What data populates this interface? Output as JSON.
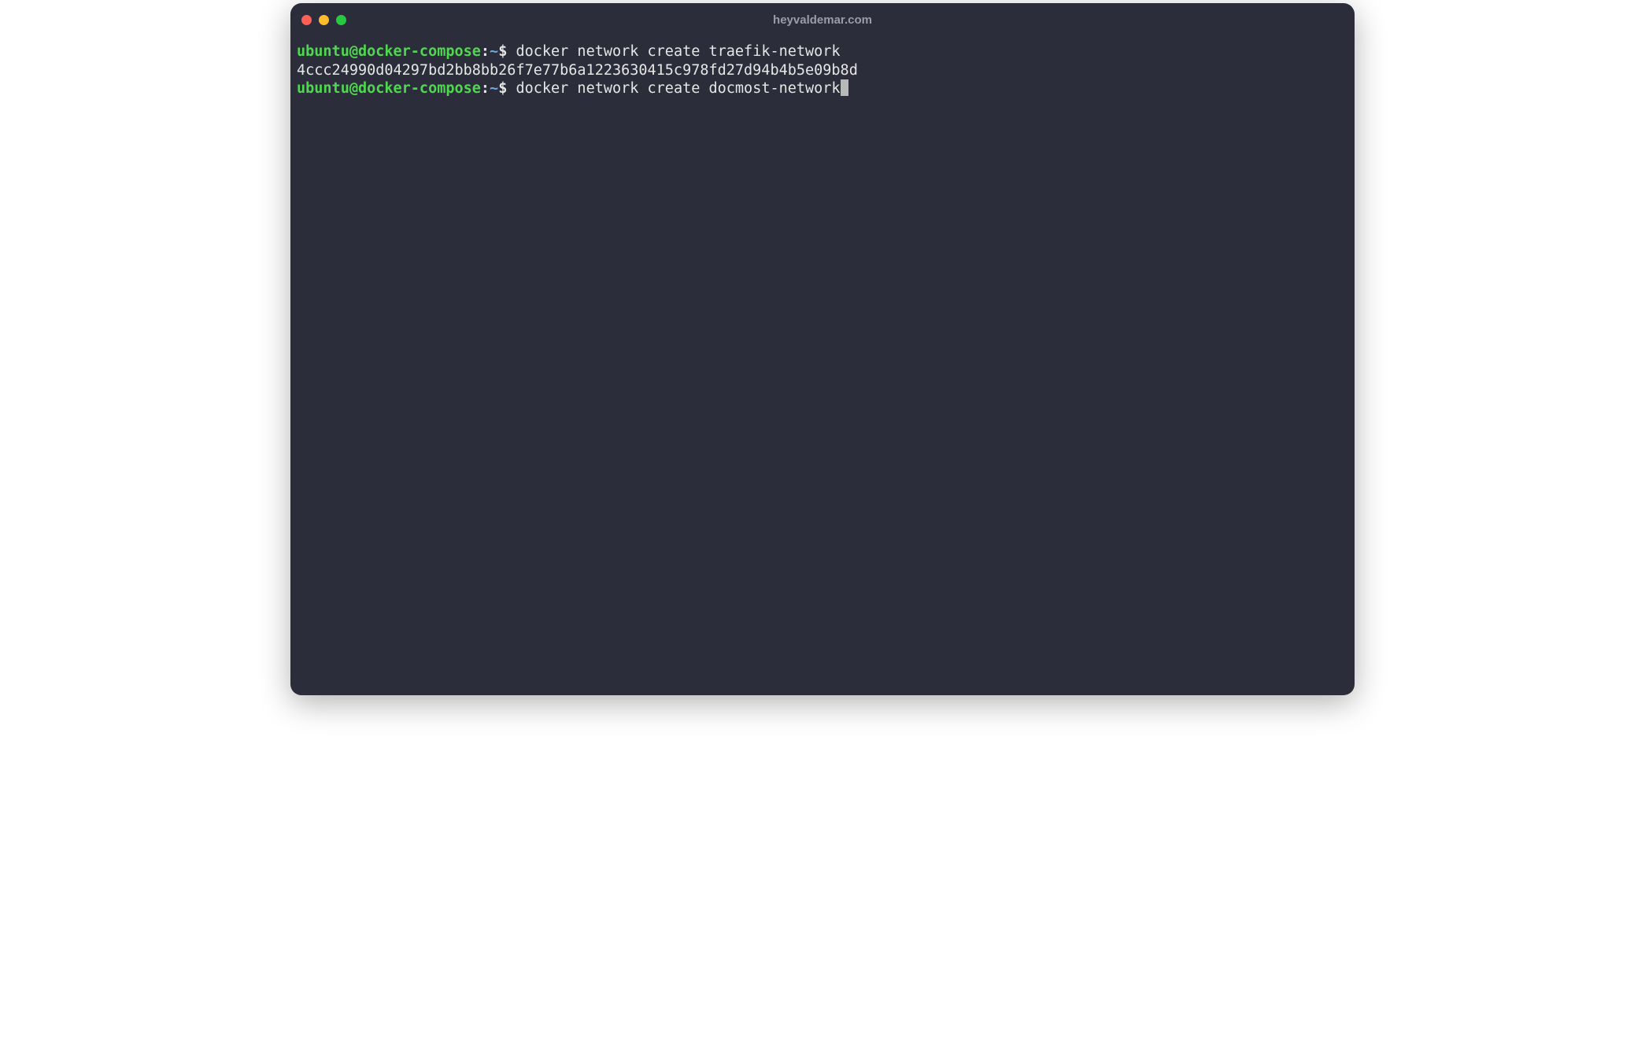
{
  "window": {
    "title": "heyvaldemar.com"
  },
  "prompt": {
    "user": "ubuntu",
    "at": "@",
    "host": "docker-compose",
    "colon": ":",
    "path": "~",
    "dollar": "$"
  },
  "lines": {
    "l1_cmd": " docker network create traefik-network",
    "l2_output": "4ccc24990d04297bd2bb8bb26f7e77b6a1223630415c978fd27d94b4b5e09b8d",
    "l3_cmd": " docker network create docmost-network"
  },
  "colors": {
    "background": "#2b2d3a",
    "prompt_user": "#4fd84f",
    "prompt_path": "#6fa8dc",
    "text": "#e6e6e6",
    "title": "#9a9caa"
  }
}
